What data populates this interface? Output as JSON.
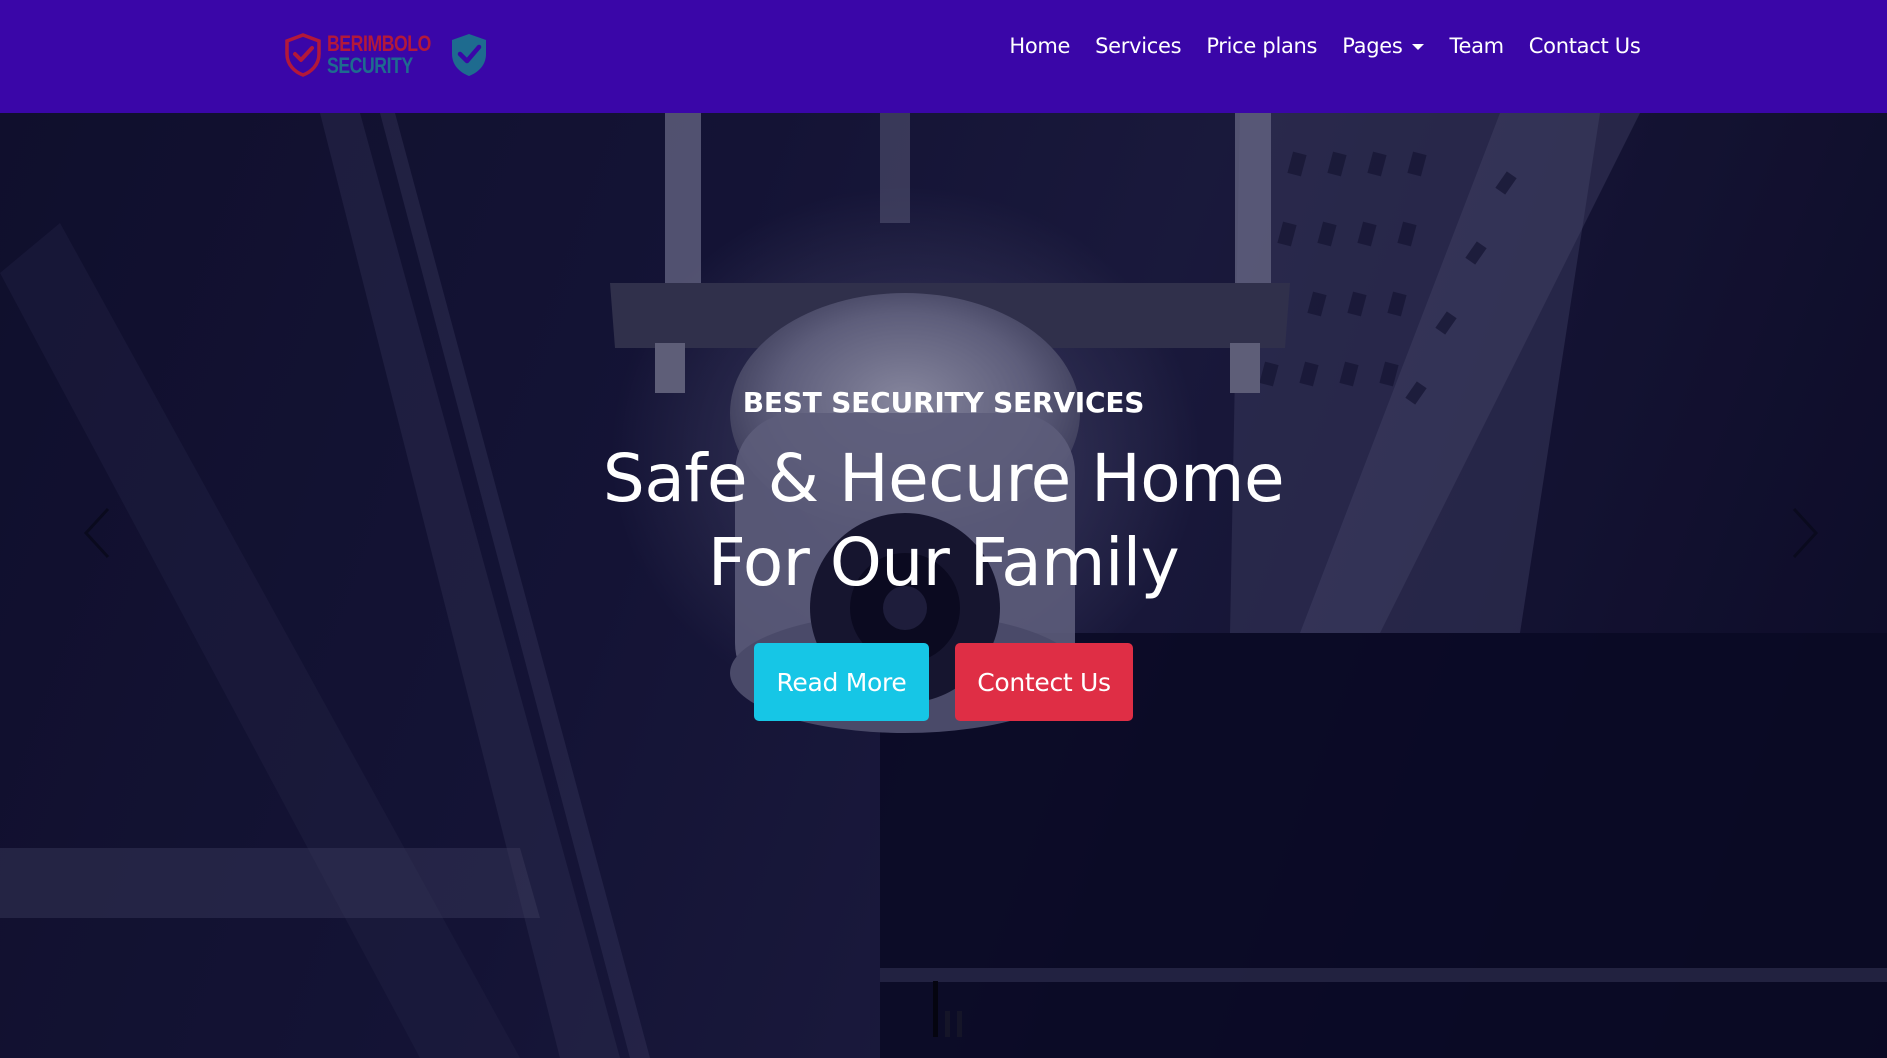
{
  "brand": {
    "logo_line1": "BERIMBOLO",
    "logo_line2": "SECURITY",
    "logo_icon_left": "shield-check-outline-icon",
    "logo_icon_right": "shield-check-icon",
    "colors": {
      "line1": "#b3183a",
      "line2": "#1e6b8f",
      "shield_right": "#1e6b8f"
    }
  },
  "nav": {
    "background": "#3a06a8",
    "items": [
      {
        "label": "Home"
      },
      {
        "label": "Services"
      },
      {
        "label": "Price plans"
      },
      {
        "label": "Pages",
        "dropdown": true
      },
      {
        "label": "Team"
      },
      {
        "label": "Contact Us"
      }
    ]
  },
  "hero": {
    "kicker": "BEST SECURITY SERVICES",
    "title_line1": "Safe & Hecure Home",
    "title_line2": "For Our Family",
    "buttons": {
      "read_more": "Read More",
      "contact": "Contect Us"
    },
    "button_colors": {
      "read_more": "#16c6e6",
      "contact": "#df2e45"
    },
    "prev_icon": "chevron-left-icon",
    "next_icon": "chevron-right-icon",
    "scroll_icon": "scroll-indicator-icon"
  }
}
